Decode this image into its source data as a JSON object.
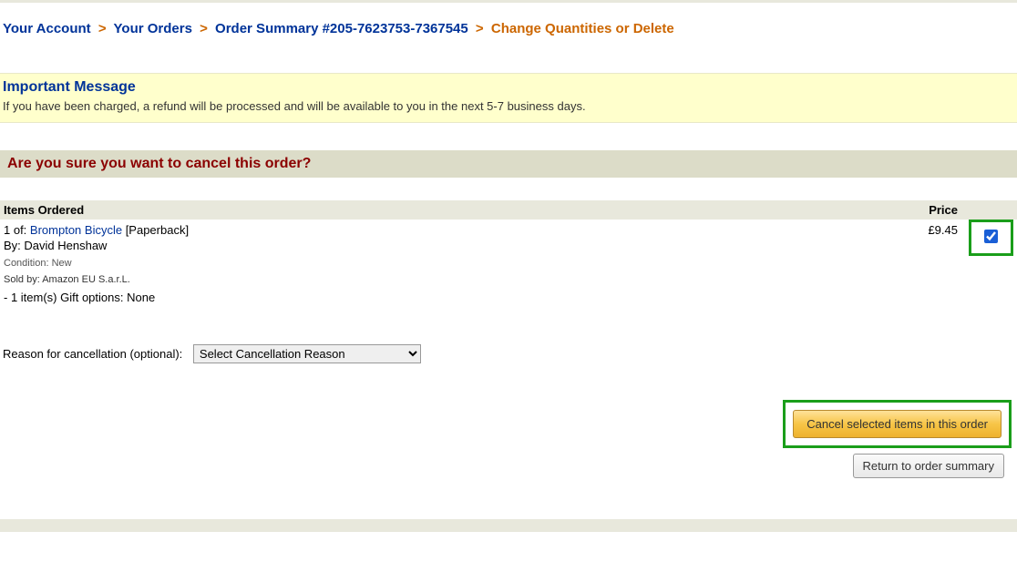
{
  "breadcrumb": {
    "your_account": "Your Account",
    "your_orders": "Your Orders",
    "order_summary": "Order Summary #205-7623753-7367545",
    "current": "Change Quantities or Delete"
  },
  "important": {
    "title": "Important Message",
    "text": "If you have been charged, a refund will be processed and will be available to you in the next 5-7 business days."
  },
  "confirm_heading": "Are you sure you want to cancel this order?",
  "items": {
    "header_items": "Items Ordered",
    "header_price": "Price",
    "row": {
      "qty_prefix": "1 of: ",
      "title": "Brompton Bicycle",
      "format": " [Paperback]",
      "author": "By: David Henshaw",
      "condition": "Condition: New",
      "seller": "Sold by: Amazon EU S.a.r.L.",
      "gift": "- 1 item(s) Gift options: None",
      "price": "£9.45"
    }
  },
  "reason": {
    "label": "Reason for cancellation (optional):",
    "placeholder": "Select Cancellation Reason"
  },
  "buttons": {
    "cancel": "Cancel selected items in this order",
    "return": "Return to order summary"
  }
}
